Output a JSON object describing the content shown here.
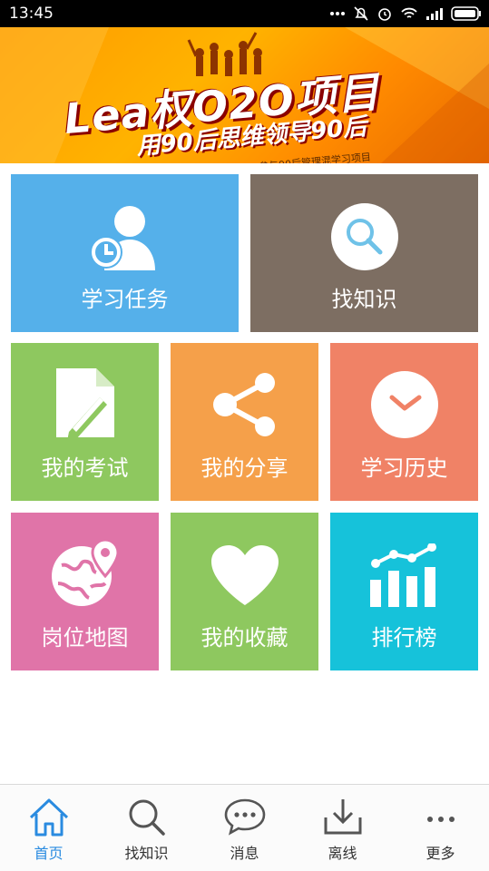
{
  "status_bar": {
    "time": "13:45"
  },
  "banner": {
    "title": "Lea权O2O项目",
    "subtitle": "用90后思维领导90后",
    "note": "参与90后管理混学习项目"
  },
  "tiles": [
    {
      "label": "学习任务",
      "color": "#55b0ea",
      "icon": "person-clock-icon"
    },
    {
      "label": "找知识",
      "color": "#7d6e62",
      "icon": "search-icon"
    },
    {
      "label": "我的考试",
      "color": "#8ec85f",
      "icon": "exam-doc-icon"
    },
    {
      "label": "我的分享",
      "color": "#f5a04a",
      "icon": "share-icon"
    },
    {
      "label": "学习历史",
      "color": "#f08266",
      "icon": "clock-icon"
    },
    {
      "label": "岗位地图",
      "color": "#e074a8",
      "icon": "globe-pin-icon"
    },
    {
      "label": "我的收藏",
      "color": "#8ec85f",
      "icon": "heart-icon"
    },
    {
      "label": "排行榜",
      "color": "#16c2da",
      "icon": "ranking-chart-icon"
    }
  ],
  "tabbar": {
    "items": [
      {
        "label": "首页",
        "icon": "home-icon",
        "active": true
      },
      {
        "label": "找知识",
        "icon": "search-icon",
        "active": false
      },
      {
        "label": "消息",
        "icon": "chat-bubble-icon",
        "active": false
      },
      {
        "label": "离线",
        "icon": "download-icon",
        "active": false
      },
      {
        "label": "更多",
        "icon": "more-dots-icon",
        "active": false
      }
    ],
    "active_color": "#2a8be0"
  }
}
